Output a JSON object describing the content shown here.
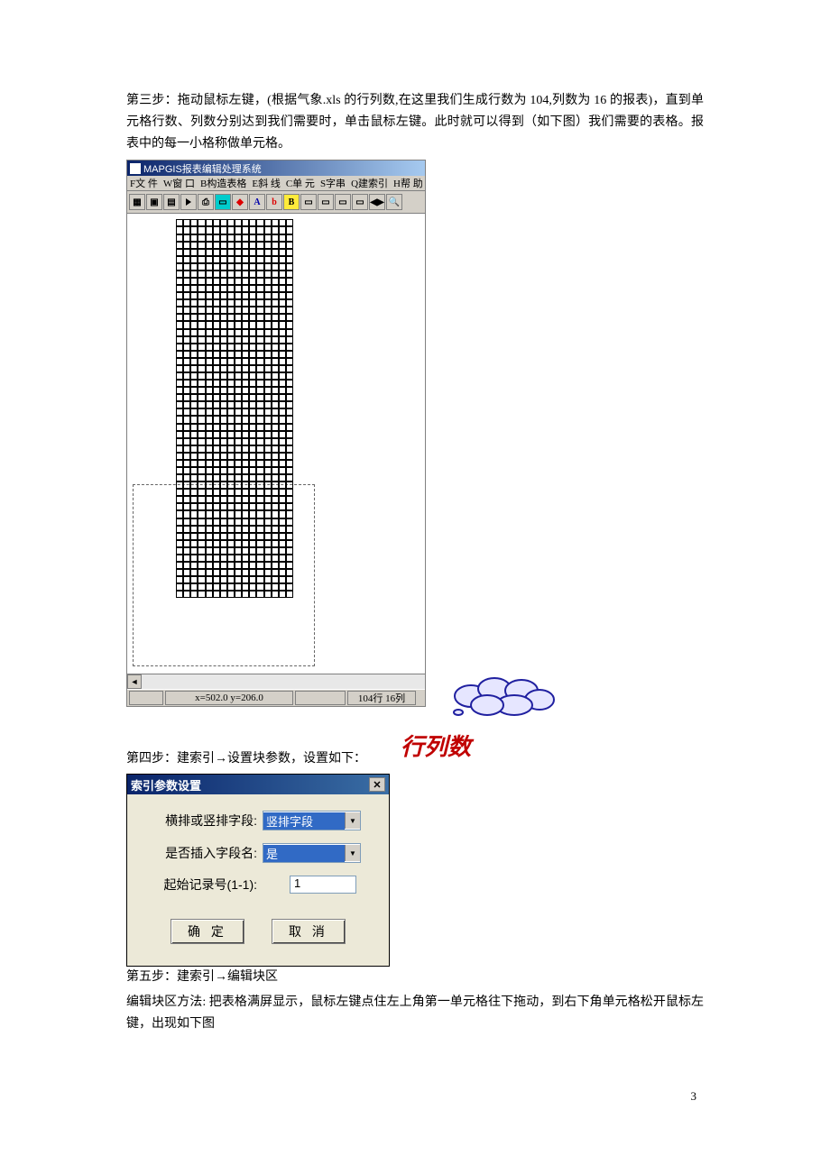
{
  "text": {
    "p1": "第三步：拖动鼠标左键，(根据气象.xls 的行列数,在这里我们生成行数为 104,列数为 16 的报表)，直到单元格行数、列数分别达到我们需要时，单击鼠标左键。此时就可以得到（如下图）我们需要的表格。报表中的每一小格称做单元格。",
    "p2": "第四步：建索引→设置块参数，设置如下：",
    "p3": "第五步：建索引→编辑块区",
    "p4": "编辑块区方法: 把表格满屏显示，鼠标左键点住左上角第一单元格往下拖动，到右下角单元格松开鼠标左键，出现如下图"
  },
  "app": {
    "title": "MAPGIS报表编辑处理系统",
    "menu": [
      "F文 件",
      "W窗 口",
      "B构造表格",
      "E斜 线",
      "C单 元",
      "S字串",
      "Q建索引",
      "H帮 助"
    ],
    "status_coord": "x=502.0   y=206.0",
    "status_rc": "104行 16列"
  },
  "callout": "行列数",
  "dialog": {
    "title": "索引参数设置",
    "row1_label": "横排或竖排字段:",
    "row1_value": "竖排字段",
    "row2_label": "是否插入字段名:",
    "row2_value": "是",
    "row3_label": "起始记录号(1-1):",
    "row3_value": "1",
    "ok": "确 定",
    "cancel": "取 消"
  },
  "page_number": "3"
}
